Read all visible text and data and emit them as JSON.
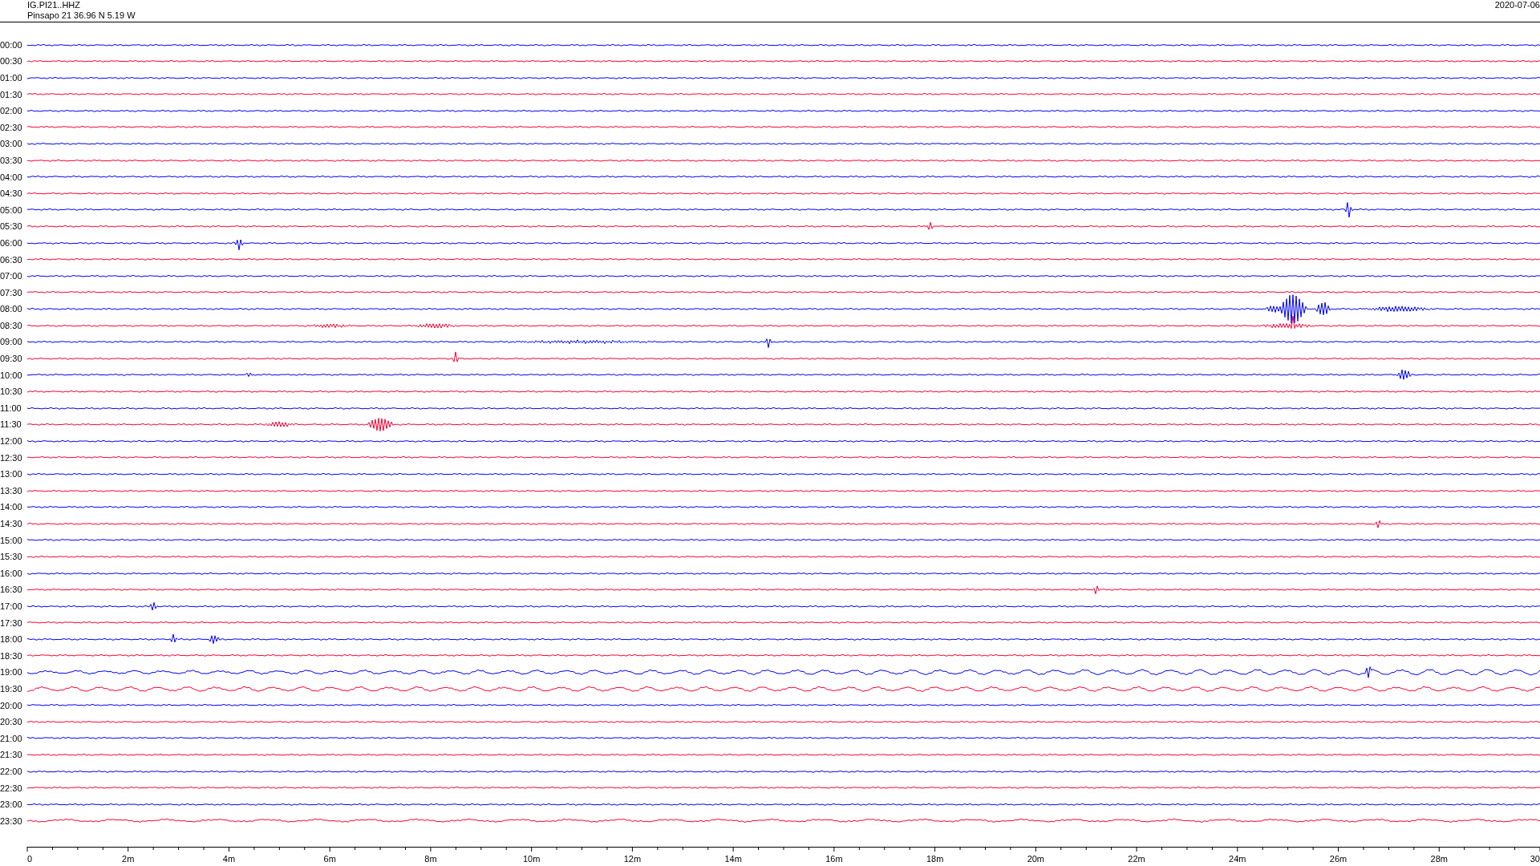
{
  "header": {
    "channel": "IG.PI21..HHZ",
    "station": "Pinsapo 21  36.96 N 5.19 W",
    "date": "2020-07-06"
  },
  "traces": [
    {
      "time": "00:00",
      "color": "#0000ff"
    },
    {
      "time": "00:30",
      "color": "#ff0033"
    },
    {
      "time": "01:00",
      "color": "#0000ff"
    },
    {
      "time": "01:30",
      "color": "#ff0033"
    },
    {
      "time": "02:00",
      "color": "#0000ff"
    },
    {
      "time": "02:30",
      "color": "#ff0033"
    },
    {
      "time": "03:00",
      "color": "#0000ff"
    },
    {
      "time": "03:30",
      "color": "#ff0033"
    },
    {
      "time": "04:00",
      "color": "#0000ff"
    },
    {
      "time": "04:30",
      "color": "#ff0033"
    },
    {
      "time": "05:00",
      "color": "#0000ff"
    },
    {
      "time": "05:30",
      "color": "#ff0033"
    },
    {
      "time": "06:00",
      "color": "#0000ff"
    },
    {
      "time": "06:30",
      "color": "#ff0033"
    },
    {
      "time": "07:00",
      "color": "#0000ff"
    },
    {
      "time": "07:30",
      "color": "#ff0033"
    },
    {
      "time": "08:00",
      "color": "#0000ff"
    },
    {
      "time": "08:30",
      "color": "#ff0033"
    },
    {
      "time": "09:00",
      "color": "#0000ff"
    },
    {
      "time": "09:30",
      "color": "#ff0033"
    },
    {
      "time": "10:00",
      "color": "#0000ff"
    },
    {
      "time": "10:30",
      "color": "#ff0033"
    },
    {
      "time": "11:00",
      "color": "#0000ff"
    },
    {
      "time": "11:30",
      "color": "#ff0033"
    },
    {
      "time": "12:00",
      "color": "#0000ff"
    },
    {
      "time": "12:30",
      "color": "#ff0033"
    },
    {
      "time": "13:00",
      "color": "#0000ff"
    },
    {
      "time": "13:30",
      "color": "#ff0033"
    },
    {
      "time": "14:00",
      "color": "#0000ff"
    },
    {
      "time": "14:30",
      "color": "#ff0033"
    },
    {
      "time": "15:00",
      "color": "#0000ff"
    },
    {
      "time": "15:30",
      "color": "#ff0033"
    },
    {
      "time": "16:00",
      "color": "#0000ff"
    },
    {
      "time": "16:30",
      "color": "#ff0033"
    },
    {
      "time": "17:00",
      "color": "#0000ff"
    },
    {
      "time": "17:30",
      "color": "#ff0033"
    },
    {
      "time": "18:00",
      "color": "#0000ff"
    },
    {
      "time": "18:30",
      "color": "#ff0033"
    },
    {
      "time": "19:00",
      "color": "#0000ff"
    },
    {
      "time": "19:30",
      "color": "#ff0033"
    },
    {
      "time": "20:00",
      "color": "#0000ff"
    },
    {
      "time": "20:30",
      "color": "#ff0033"
    },
    {
      "time": "21:00",
      "color": "#0000ff"
    },
    {
      "time": "21:30",
      "color": "#ff0033"
    },
    {
      "time": "22:00",
      "color": "#0000ff"
    },
    {
      "time": "22:30",
      "color": "#ff0033"
    },
    {
      "time": "23:00",
      "color": "#0000ff"
    },
    {
      "time": "23:30",
      "color": "#ff0033"
    }
  ],
  "axis": {
    "labels": [
      "0",
      "2m",
      "4m",
      "6m",
      "8m",
      "10m",
      "12m",
      "14m",
      "16m",
      "18m",
      "20m",
      "22m",
      "24m",
      "26m",
      "28m",
      "30"
    ]
  }
}
